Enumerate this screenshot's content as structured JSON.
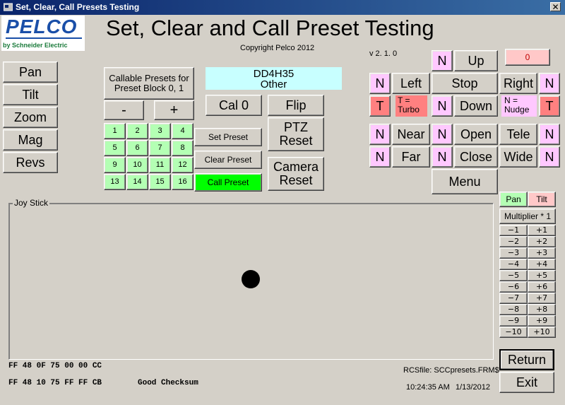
{
  "window": {
    "title": "Set, Clear, Call Presets Testing",
    "close_glyph": "✕"
  },
  "logo": {
    "brand": "PELCO",
    "tagline": "by Schneider Electric"
  },
  "header": {
    "title": "Set, Clear and Call Preset Testing",
    "copyright": "Copyright Pelco 2012",
    "version": "v 2. 1. 0"
  },
  "left_nav": {
    "pan": "Pan",
    "tilt": "Tilt",
    "zoom": "Zoom",
    "mag": "Mag",
    "revs": "Revs"
  },
  "presets": {
    "callable_label": "Callable Presets for Preset Block 0, 1",
    "minus": "-",
    "plus": "+",
    "numbers": [
      "1",
      "2",
      "3",
      "4",
      "5",
      "6",
      "7",
      "8",
      "9",
      "10",
      "11",
      "12",
      "13",
      "14",
      "15",
      "16"
    ],
    "set": "Set Preset",
    "clear": "Clear Preset",
    "call": "Call Preset",
    "active_color": "#00ff00",
    "preset_color": "#b4ffb4"
  },
  "device": {
    "id": "DD4H35",
    "type": "Other"
  },
  "camera_buttons": {
    "cal": "Cal 0",
    "flip": "Flip",
    "ptz_reset": "PTZ Reset",
    "camera_reset": "Camera Reset"
  },
  "ptz": {
    "speed": "0",
    "n": "N",
    "t": "T",
    "up": "Up",
    "left": "Left",
    "stop": "Stop",
    "right": "Right",
    "down": "Down",
    "turbo": "T = Turbo",
    "nudge": "N = Nudge",
    "near": "Near",
    "open": "Open",
    "tele": "Tele",
    "far": "Far",
    "close": "Close",
    "wide": "Wide",
    "menu": "Menu"
  },
  "joystick": {
    "label": "Joy Stick"
  },
  "multiplier": {
    "pan": "Pan",
    "tilt": "Tilt",
    "label": "Multiplier * 1",
    "negatives": [
      "−1",
      "−2",
      "−3",
      "−4",
      "−5",
      "−6",
      "−7",
      "−8",
      "−9",
      "−10"
    ],
    "positives": [
      "+1",
      "+2",
      "+3",
      "+4",
      "+5",
      "+6",
      "+7",
      "+8",
      "+9",
      "+10"
    ]
  },
  "status": {
    "hex1": "FF 48 0F 75 00 00 CC",
    "hex2": "FF 48 10 75 FF FF CB",
    "checksum": "Good Checksum",
    "rcs_file": "RCSfile: SCCpresets.FRM$",
    "time": "10:24:35 AM",
    "date": "1/13/2012"
  },
  "actions": {
    "return": "Return",
    "exit": "Exit"
  },
  "colors": {
    "pink": "#ffc8ff",
    "salmon": "#ff8080",
    "cyan": "#c8ffff",
    "face": "#d4d0c8",
    "titlebar": "#0a246a"
  }
}
